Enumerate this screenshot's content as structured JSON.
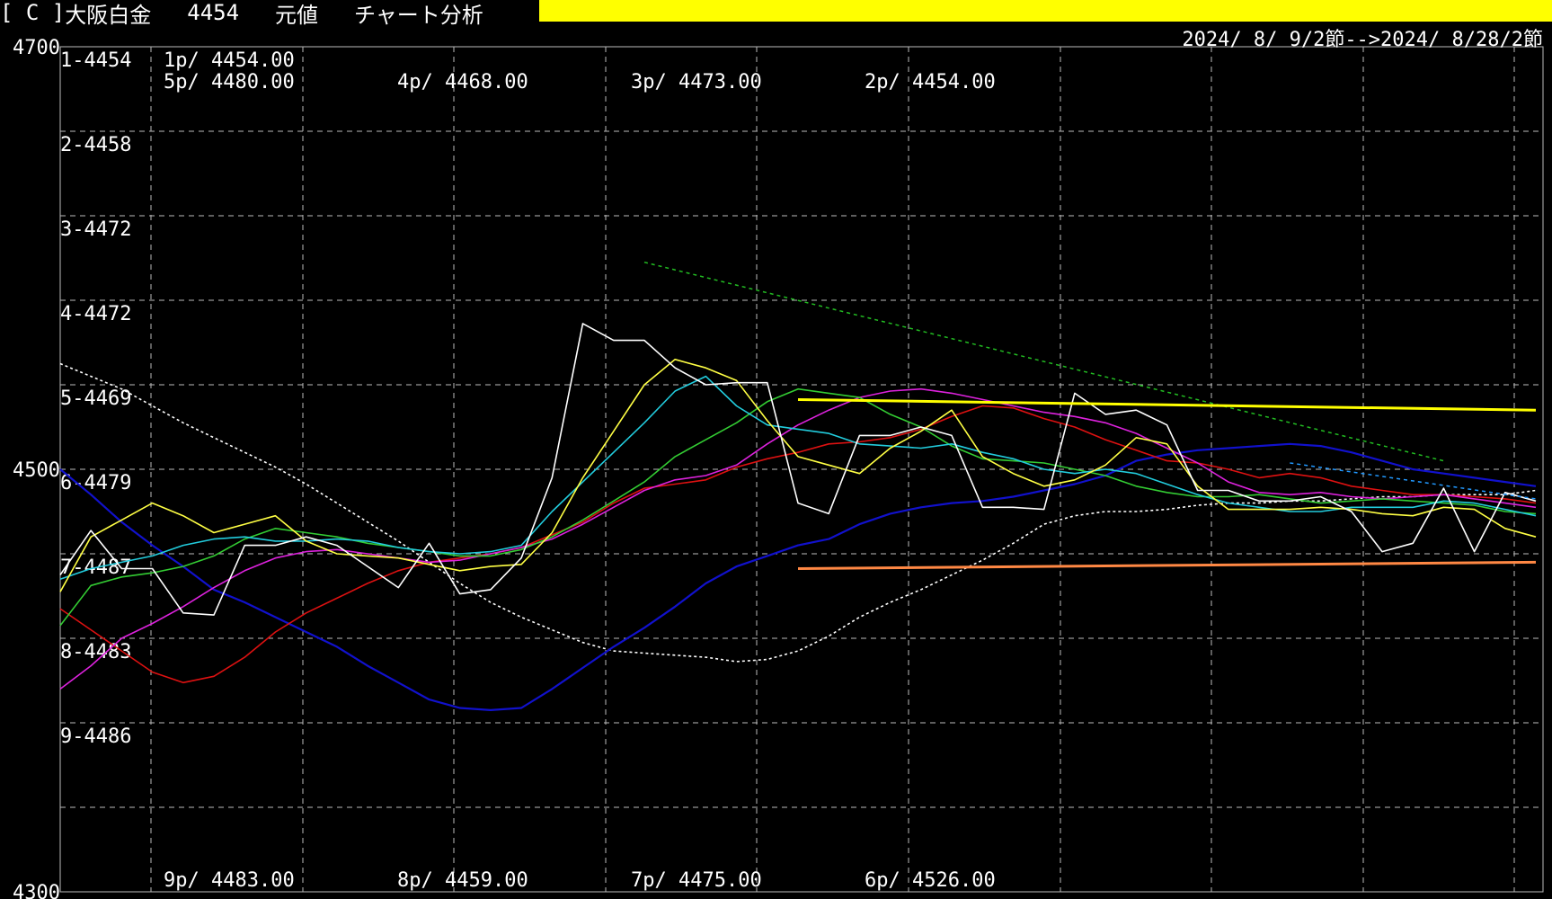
{
  "header": {
    "bracket": "[ C ]",
    "instrument": "大阪白金",
    "code": "4454",
    "mode": "元値",
    "analysis": "チャート分析",
    "date_range": "2024/ 8/ 9/2節-->2024/ 8/28/2節"
  },
  "colors": {
    "background": "#000000",
    "header_bar": "#ffff00",
    "grid": "#bbbbbb",
    "price": "#ffffff",
    "ma_yellow": "#ffff44",
    "ma_cyan": "#22ccdd",
    "ma_green": "#33cc33",
    "ma_magenta": "#dd22dd",
    "ma_red": "#dd1111",
    "ma_blue": "#1111cc",
    "ma_long_dotted": "#ffffff",
    "trend_green_dotted": "#22bb22",
    "trend_blue_dotted": "#2299ff",
    "resistance": "#ffff00",
    "support": "#ff8844"
  },
  "chart_data": {
    "type": "line",
    "ylim": [
      4300,
      4700
    ],
    "y_ticks": [
      "4700",
      "4500",
      "4300"
    ],
    "row_labels": [
      "1-4454",
      "2-4458",
      "3-4472",
      "4-4472",
      "5-4469",
      "6-4479",
      "7-4487",
      "8-4483",
      "9-4486"
    ],
    "top_labels": [
      {
        "text": "1p/ 4454.00"
      },
      {
        "text": "5p/ 4480.00"
      },
      {
        "text": "4p/ 4468.00"
      },
      {
        "text": "3p/ 4473.00"
      },
      {
        "text": "2p/ 4454.00"
      }
    ],
    "bottom_labels": [
      {
        "text": "9p/ 4483.00"
      },
      {
        "text": "8p/ 4459.00"
      },
      {
        "text": "7p/ 4475.00"
      },
      {
        "text": "6p/ 4526.00"
      }
    ],
    "x": [
      0,
      1,
      2,
      3,
      4,
      5,
      6,
      7,
      8,
      9,
      10,
      11,
      12,
      13,
      14,
      15,
      16,
      17,
      18,
      19,
      20,
      21,
      22,
      23,
      24,
      25,
      26,
      27,
      28,
      29,
      30,
      31,
      32,
      33,
      34,
      35,
      36,
      37,
      38,
      39,
      40,
      41,
      42,
      43,
      44,
      45,
      46,
      47,
      48
    ],
    "series": [
      {
        "key": "price",
        "values": [
          4450,
          4471,
          4453,
          4453,
          4432,
          4431,
          4464,
          4464,
          4468,
          4464,
          4454,
          4444,
          4465,
          4441,
          4443,
          4458,
          4496,
          4569,
          4561,
          4561,
          4548,
          4540,
          4541,
          4541,
          4484,
          4479,
          4516,
          4516,
          4520,
          4516,
          4482,
          4482,
          4481,
          4536,
          4526,
          4528,
          4521,
          4490,
          4490,
          4485,
          4485,
          4487,
          4480,
          4461,
          4465,
          4491,
          4461,
          4489,
          4485
        ]
      },
      {
        "key": "ma_yellow",
        "values": [
          4442,
          4468,
          4476,
          4484,
          4478,
          4470,
          4474,
          4478,
          4466,
          4460,
          4459,
          4458,
          4455,
          4452,
          4454,
          4455,
          4470,
          4496,
          4518,
          4540,
          4552,
          4548,
          4542,
          4523,
          4506,
          4502,
          4498,
          4510,
          4518,
          4528,
          4506,
          4498,
          4492,
          4495,
          4502,
          4515,
          4512,
          4492,
          4481,
          4481,
          4481,
          4482,
          4481,
          4479,
          4478,
          4482,
          4481,
          4472,
          4468
        ]
      },
      {
        "key": "ma_cyan",
        "values": [
          4448,
          4453,
          4456,
          4459,
          4464,
          4467,
          4468,
          4466,
          4466,
          4467,
          4466,
          4463,
          4461,
          4460,
          4461,
          4464,
          4480,
          4494,
          4508,
          4522,
          4537,
          4544,
          4530,
          4521,
          4519,
          4517,
          4512,
          4511,
          4510,
          4512,
          4508,
          4505,
          4500,
          4498,
          4500,
          4498,
          4493,
          4488,
          4484,
          4482,
          4480,
          4480,
          4482,
          4482,
          4482,
          4485,
          4484,
          4481,
          4478
        ]
      },
      {
        "key": "ma_green",
        "values": [
          4426,
          4445,
          4449,
          4451,
          4454,
          4459,
          4467,
          4472,
          4470,
          4468,
          4465,
          4463,
          4461,
          4459,
          4459,
          4462,
          4468,
          4476,
          4485,
          4494,
          4506,
          4514,
          4522,
          4532,
          4538,
          4536,
          4534,
          4526,
          4520,
          4511,
          4505,
          4504,
          4503,
          4500,
          4497,
          4492,
          4489,
          4487,
          4487,
          4488,
          4486,
          4484,
          4485,
          4486,
          4485,
          4484,
          4483,
          4480,
          4479
        ]
      },
      {
        "key": "ma_magenta",
        "values": [
          4396,
          4407,
          4420,
          4427,
          4435,
          4444,
          4452,
          4458,
          4461,
          4462,
          4460,
          4458,
          4456,
          4457,
          4460,
          4463,
          4467,
          4474,
          4482,
          4490,
          4495,
          4497,
          4502,
          4512,
          4521,
          4528,
          4534,
          4537,
          4538,
          4536,
          4533,
          4530,
          4527,
          4525,
          4522,
          4517,
          4510,
          4503,
          4494,
          4489,
          4488,
          4489,
          4487,
          4486,
          4487,
          4488,
          4486,
          4484,
          4482
        ]
      },
      {
        "key": "ma_red",
        "values": [
          4434,
          4424,
          4414,
          4404,
          4399,
          4402,
          4411,
          4423,
          4432,
          4439,
          4446,
          4452,
          4456,
          4458,
          4460,
          4463,
          4469,
          4475,
          4484,
          4491,
          4493,
          4495,
          4501,
          4505,
          4508,
          4512,
          4513,
          4515,
          4519,
          4525,
          4530,
          4529,
          4524,
          4520,
          4514,
          4509,
          4504,
          4503,
          4500,
          4496,
          4498,
          4496,
          4492,
          4490,
          4488,
          4488,
          4487,
          4486,
          4484
        ]
      },
      {
        "key": "ma_blue",
        "values": [
          4500,
          4488,
          4475,
          4464,
          4454,
          4443,
          4437,
          4430,
          4423,
          4416,
          4407,
          4399,
          4391,
          4387,
          4386,
          4387,
          4396,
          4406,
          4416,
          4425,
          4435,
          4446,
          4454,
          4459,
          4464,
          4467,
          4474,
          4479,
          4482,
          4484,
          4485,
          4487,
          4490,
          4493,
          4497,
          4504,
          4507,
          4509,
          4510,
          4511,
          4512,
          4511,
          4508,
          4504,
          4500,
          4498,
          4496,
          4494,
          4492
        ]
      },
      {
        "key": "ma_long_dotted",
        "values": [
          4550,
          4544,
          4538,
          4530,
          4522,
          4515,
          4508,
          4501,
          4493,
          4484,
          4475,
          4466,
          4456,
          4446,
          4437,
          4430,
          4424,
          4418,
          4414,
          4413,
          4412,
          4411,
          4409,
          4410,
          4414,
          4421,
          4430,
          4437,
          4443,
          4450,
          4457,
          4465,
          4474,
          4478,
          4480,
          4480,
          4481,
          4483,
          4484,
          4484,
          4485,
          4485,
          4486,
          4487,
          4487,
          4488,
          4488,
          4488,
          4490
        ]
      }
    ],
    "trendlines": [
      {
        "key": "trend_green_dotted",
        "x": [
          19,
          45
        ],
        "y": [
          4598,
          4504
        ]
      },
      {
        "key": "trend_blue_dotted",
        "x": [
          40,
          48
        ],
        "y": [
          4503,
          4486
        ]
      },
      {
        "key": "resistance",
        "x": [
          24,
          48
        ],
        "y": [
          4533,
          4528
        ]
      },
      {
        "key": "support",
        "x": [
          24,
          48
        ],
        "y": [
          4453,
          4456
        ]
      }
    ]
  }
}
